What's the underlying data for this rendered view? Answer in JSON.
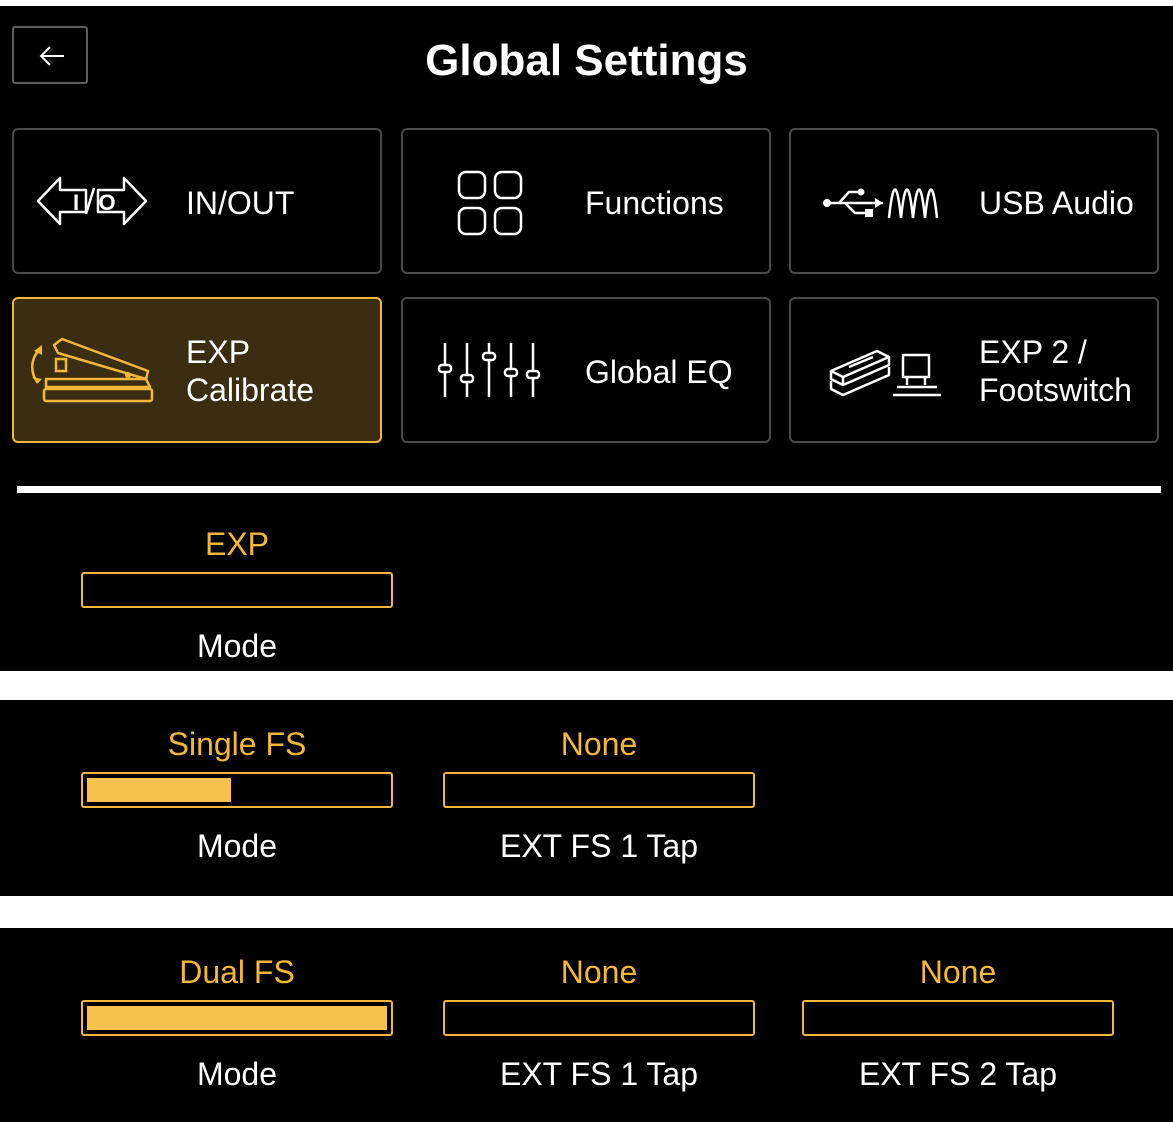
{
  "header": {
    "title": "Global Settings",
    "back_icon": "arrow-left-icon"
  },
  "tiles": [
    {
      "label": "IN/OUT",
      "icon": "io-arrows-icon",
      "active": false
    },
    {
      "label": "Functions",
      "icon": "grid-icon",
      "active": false
    },
    {
      "label": "USB Audio",
      "icon": "usb-wave-icon",
      "active": false
    },
    {
      "label": "EXP\nCalibrate",
      "icon": "expression-pedal-icon",
      "active": true
    },
    {
      "label": "Global EQ",
      "icon": "eq-sliders-icon",
      "active": false
    },
    {
      "label": "EXP 2 /\nFootswitch",
      "icon": "pedal-footswitch-icon",
      "active": false
    }
  ],
  "colors": {
    "accent": "#f5b73b",
    "active_tile_bg": "#3a2d12",
    "background": "#000000"
  },
  "exp_panel": {
    "controls": [
      {
        "value": "EXP",
        "name": "Mode",
        "fill": 0
      }
    ]
  },
  "single_fs_panel": {
    "controls": [
      {
        "value": "Single FS",
        "name": "Mode",
        "fill": 0.48
      },
      {
        "value": "None",
        "name": "EXT FS 1 Tap",
        "fill": 0
      }
    ]
  },
  "dual_fs_panel": {
    "controls": [
      {
        "value": "Dual FS",
        "name": "Mode",
        "fill": 1.0
      },
      {
        "value": "None",
        "name": "EXT FS 1 Tap",
        "fill": 0
      },
      {
        "value": "None",
        "name": "EXT FS 2 Tap",
        "fill": 0
      }
    ]
  }
}
